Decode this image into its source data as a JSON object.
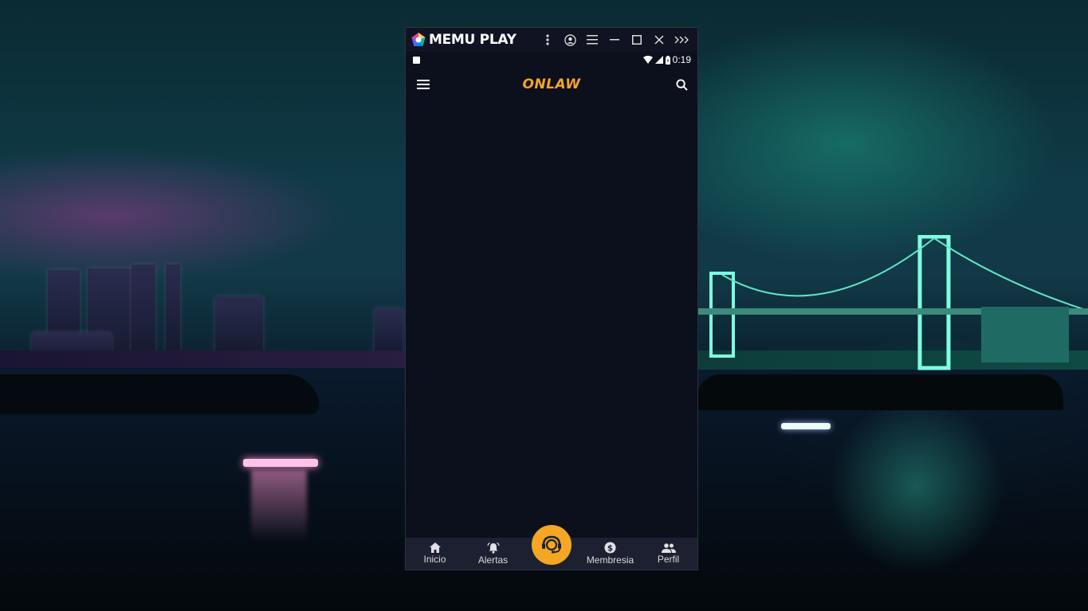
{
  "emulator": {
    "brand": "MEMU PLAY",
    "titlebar_buttons": [
      "more-icon",
      "account-icon",
      "menu-icon",
      "minimize-icon",
      "maximize-icon",
      "close-icon",
      "expand-icon"
    ]
  },
  "statusbar": {
    "time": "0:19"
  },
  "app": {
    "title": "ONLAW",
    "accent_color": "#f5a623",
    "background_color": "#0c0f1c"
  },
  "bottom_nav": {
    "items": [
      {
        "label": "Inicio",
        "icon": "home-icon"
      },
      {
        "label": "Alertas",
        "icon": "bell-icon"
      },
      {
        "label": "Membresia",
        "icon": "dollar-icon"
      },
      {
        "label": "Perfil",
        "icon": "people-icon"
      }
    ],
    "center_button_icon": "support-agent-icon"
  }
}
